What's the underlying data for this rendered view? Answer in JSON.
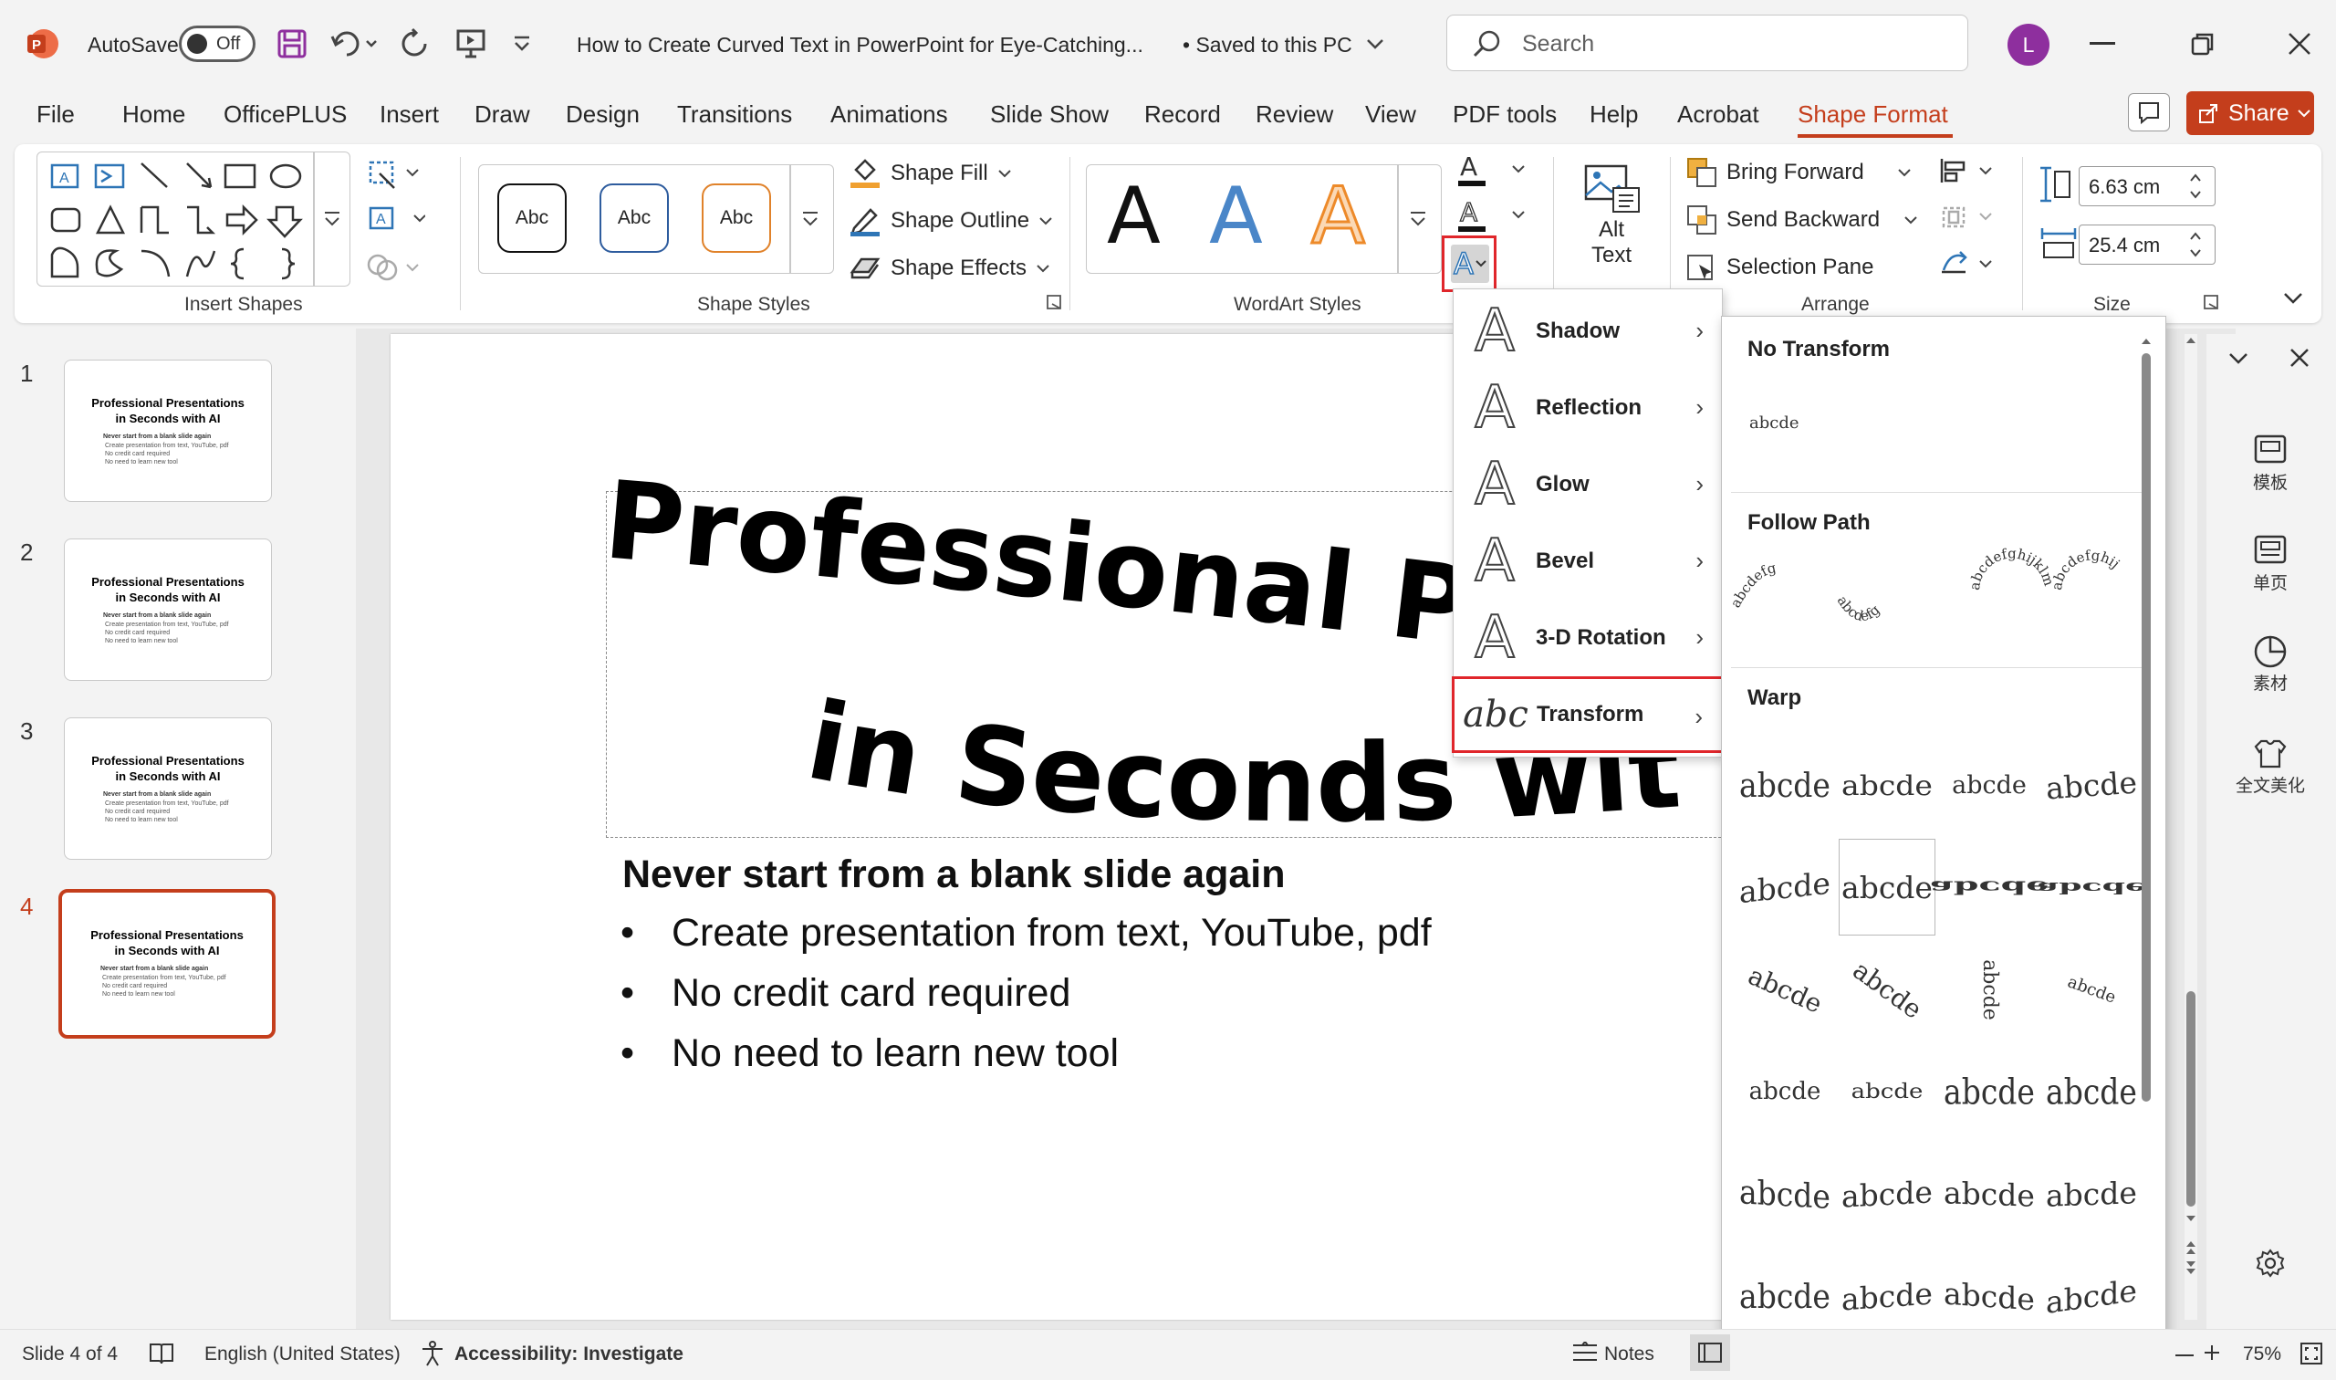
{
  "titlebar": {
    "autosave_label": "AutoSave",
    "autosave_state": "Off",
    "doc_title": "How to Create Curved Text in PowerPoint for Eye-Catching...",
    "save_status": "• Saved to this PC",
    "search_placeholder": "Search",
    "user_initial": "L"
  },
  "menu": {
    "tabs": [
      "File",
      "Home",
      "OfficePLUS",
      "Insert",
      "Draw",
      "Design",
      "Transitions",
      "Animations",
      "Slide Show",
      "Record",
      "Review",
      "View",
      "PDF tools",
      "Help",
      "Acrobat",
      "Shape Format"
    ],
    "active_tab": "Shape Format",
    "share_label": "Share"
  },
  "ribbon": {
    "insert_shapes_label": "Insert Shapes",
    "shape_styles_label": "Shape Styles",
    "style_sample": "Abc",
    "shape_fill": "Shape Fill",
    "shape_outline": "Shape Outline",
    "shape_effects": "Shape Effects",
    "wordart_label": "WordArt Styles",
    "wordart_sample": "A",
    "alt_text_line1": "Alt",
    "alt_text_line2": "Text",
    "bring_forward": "Bring Forward",
    "send_backward": "Send Backward",
    "selection_pane": "Selection Pane",
    "arrange_label": "Arrange",
    "height_value": "6.63 cm",
    "width_value": "25.4 cm",
    "size_label": "Size"
  },
  "thumbnails": {
    "numbers": [
      "1",
      "2",
      "3",
      "4"
    ],
    "title_line1": "Professional Presentations",
    "title_line2": "in Seconds with AI",
    "subtitle": "Never start from a blank slide again",
    "bullets": [
      "Create presentation from text, YouTube, pdf",
      "No credit card required",
      "No need to learn new tool"
    ]
  },
  "slide": {
    "title_line1": "Professional Presentations",
    "title_line2": "in Seconds with AI",
    "subtitle": "Never start from a blank slide again",
    "bullets": [
      "Create presentation from text, YouTube, pdf",
      "No credit card required",
      "No need to learn new tool"
    ],
    "bullet_char": "•"
  },
  "effects_menu": {
    "items": [
      {
        "label": "Shadow",
        "glyph": "A"
      },
      {
        "label": "Reflection",
        "glyph": "A"
      },
      {
        "label": "Glow",
        "glyph": "A"
      },
      {
        "label": "Bevel",
        "glyph": "A"
      },
      {
        "label": "3-D Rotation",
        "glyph": "A"
      },
      {
        "label": "Transform",
        "glyph": "abc"
      }
    ],
    "chevron": "›"
  },
  "gallery": {
    "no_transform": "No Transform",
    "no_transform_sample": "abcde",
    "follow_path": "Follow Path",
    "warp": "Warp",
    "warp_sample": "abcde",
    "path_samples": [
      "abcdefg",
      "abcdefg",
      "abcdefghijklm",
      "abcdefghij"
    ]
  },
  "right_pane": {
    "items": [
      "模板",
      "单页",
      "素材",
      "全文美化"
    ]
  },
  "status": {
    "slide_info": "Slide 4 of 4",
    "language": "English (United States)",
    "accessibility": "Accessibility: Investigate",
    "notes": "Notes",
    "zoom": "75%"
  },
  "colors": {
    "accent": "#c43e1c",
    "highlight_box": "#e0262b",
    "wordart_blue": "#4a86c8",
    "wordart_orange": "#ed8a2a",
    "user_avatar": "#8e2f9e"
  }
}
